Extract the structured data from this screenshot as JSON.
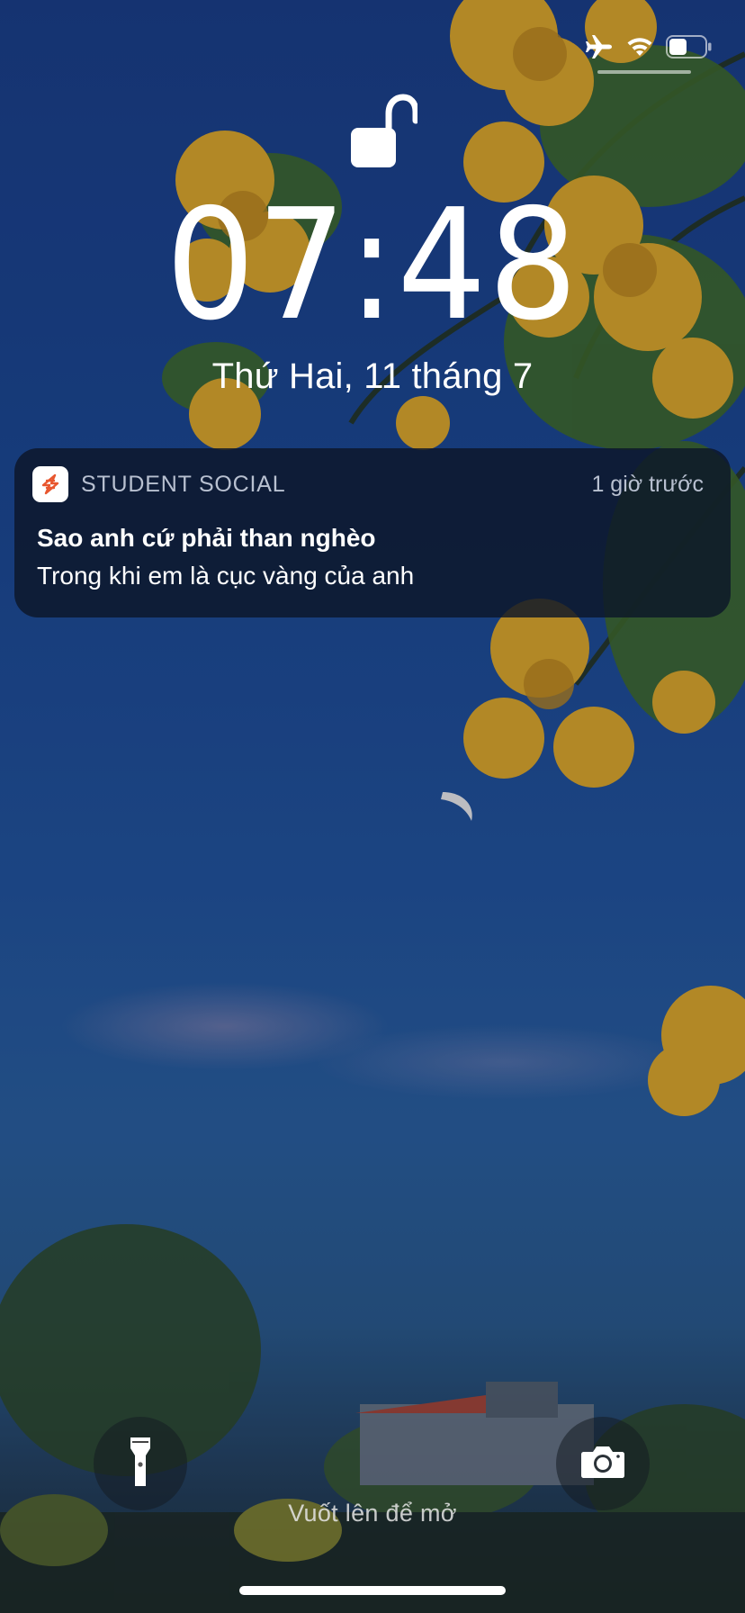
{
  "lock_screen": {
    "time": "07:48",
    "date": "Thứ Hai, 11 tháng 7",
    "lock_icon": "unlocked-padlock-icon"
  },
  "status_bar": {
    "icons": [
      "airplane-icon",
      "wifi-icon",
      "battery-icon"
    ],
    "battery_level": 0.5
  },
  "notification": {
    "app_name": "STUDENT SOCIAL",
    "time": "1 giờ trước",
    "title": "Sao anh cứ phải than nghèo",
    "body": "Trong khi em là cục vàng của anh",
    "accent_color": "#e8572f"
  },
  "bottom": {
    "swipe_hint": "Vuốt lên để mở",
    "flashlight_icon": "flashlight-icon",
    "camera_icon": "camera-icon"
  }
}
